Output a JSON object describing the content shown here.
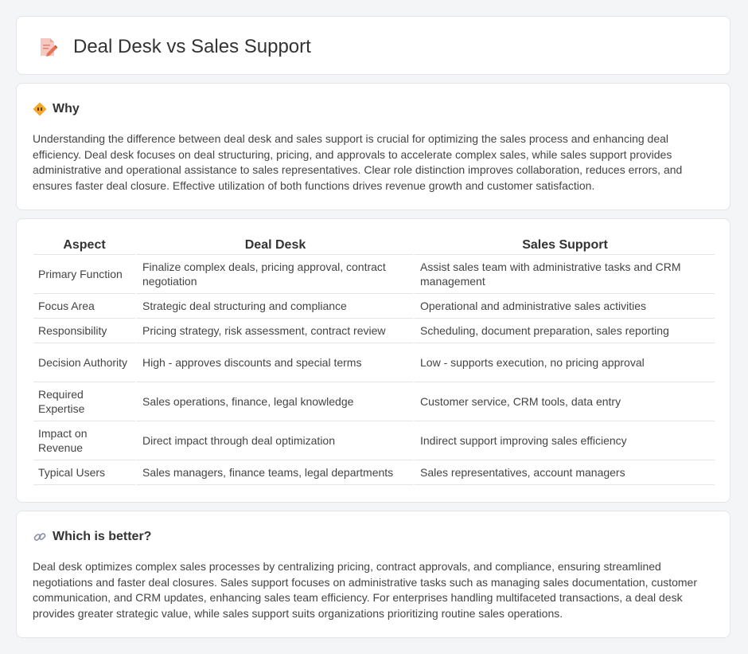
{
  "header": {
    "title": "Deal Desk vs Sales Support",
    "icon": "document-pencil-icon"
  },
  "why": {
    "title": "Why",
    "icon": "diamond-sign-icon",
    "body": "Understanding the difference between deal desk and sales support is crucial for optimizing the sales process and enhancing deal efficiency. Deal desk focuses on deal structuring, pricing, and approvals to accelerate complex sales, while sales support provides administrative and operational assistance to sales representatives. Clear role distinction improves collaboration, reduces errors, and ensures faster deal closure. Effective utilization of both functions drives revenue growth and customer satisfaction."
  },
  "table": {
    "headers": [
      "Aspect",
      "Deal Desk",
      "Sales Support"
    ],
    "rows": [
      [
        "Primary Function",
        "Finalize complex deals, pricing approval, contract negotiation",
        "Assist sales team with administrative tasks and CRM management"
      ],
      [
        "Focus Area",
        "Strategic deal structuring and compliance",
        "Operational and administrative sales activities"
      ],
      [
        "Responsibility",
        "Pricing strategy, risk assessment, contract review",
        "Scheduling, document preparation, sales reporting"
      ],
      [
        "Decision Authority",
        "High - approves discounts and special terms",
        "Low - supports execution, no pricing approval"
      ],
      [
        "Required Expertise",
        "Sales operations, finance, legal knowledge",
        "Customer service, CRM tools, data entry"
      ],
      [
        "Impact on Revenue",
        "Direct impact through deal optimization",
        "Indirect support improving sales efficiency"
      ],
      [
        "Typical Users",
        "Sales managers, finance teams, legal departments",
        "Sales representatives, account managers"
      ]
    ]
  },
  "better": {
    "title": "Which is better?",
    "icon": "link-icon",
    "body": "Deal desk optimizes complex sales processes by centralizing pricing, contract approvals, and compliance, ensuring streamlined negotiations and faster deal closures. Sales support focuses on administrative tasks such as managing sales documentation, customer communication, and CRM updates, enhancing sales team efficiency. For enterprises handling multifaceted transactions, a deal desk provides greater strategic value, while sales support suits organizations prioritizing routine sales operations."
  }
}
